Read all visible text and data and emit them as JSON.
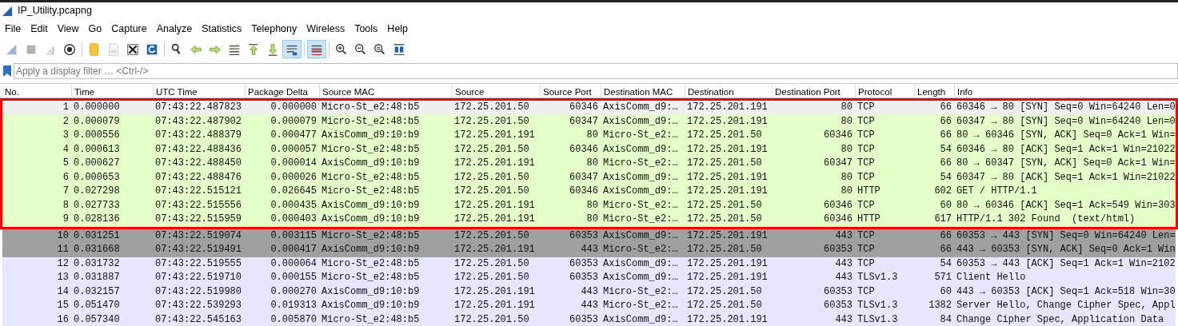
{
  "window": {
    "title": "IP_Utility.pcapng"
  },
  "menu": [
    "File",
    "Edit",
    "View",
    "Go",
    "Capture",
    "Analyze",
    "Statistics",
    "Telephony",
    "Wireless",
    "Tools",
    "Help"
  ],
  "toolbar": [
    {
      "kind": "fin",
      "disabled": true,
      "pressed": false
    },
    {
      "kind": "stop",
      "disabled": true,
      "pressed": false
    },
    {
      "kind": "restart",
      "disabled": true,
      "pressed": false
    },
    {
      "kind": "options",
      "disabled": false,
      "pressed": false
    },
    {
      "kind": "separator"
    },
    {
      "kind": "open",
      "disabled": false,
      "pressed": false
    },
    {
      "kind": "save",
      "disabled": true,
      "pressed": false
    },
    {
      "kind": "close",
      "disabled": false,
      "pressed": false
    },
    {
      "kind": "reload",
      "disabled": false,
      "pressed": false
    },
    {
      "kind": "separator"
    },
    {
      "kind": "find",
      "disabled": false,
      "pressed": false
    },
    {
      "kind": "back",
      "disabled": false,
      "pressed": false
    },
    {
      "kind": "forward",
      "disabled": false,
      "pressed": false
    },
    {
      "kind": "goto",
      "disabled": false,
      "pressed": false
    },
    {
      "kind": "first",
      "disabled": false,
      "pressed": false
    },
    {
      "kind": "last",
      "disabled": false,
      "pressed": false
    },
    {
      "kind": "autoscroll",
      "disabled": false,
      "pressed": true
    },
    {
      "kind": "separator"
    },
    {
      "kind": "colorize",
      "disabled": false,
      "pressed": true
    },
    {
      "kind": "separator"
    },
    {
      "kind": "zoomin",
      "disabled": false,
      "pressed": false
    },
    {
      "kind": "zoomout",
      "disabled": false,
      "pressed": false
    },
    {
      "kind": "zoomreset",
      "disabled": false,
      "pressed": false
    },
    {
      "kind": "resize",
      "disabled": false,
      "pressed": false
    }
  ],
  "filter": {
    "placeholder": "Apply a display filter … <Ctrl-/>"
  },
  "table": {
    "columns": [
      "No.",
      "Time",
      "UTC Time",
      "Package Delta",
      "Source MAC",
      "Source",
      "Source Port",
      "Destination MAC",
      "Destination",
      "Destination Port",
      "Protocol",
      "Length",
      "Info"
    ],
    "rows": [
      {
        "color": "#efefef",
        "highlighted": true,
        "cells": [
          "1",
          "0.000000",
          "07:43:22.487823",
          "0.000000",
          "Micro-St_e2:48:b5",
          "172.25.201.50",
          "60346",
          "AxisComm_d9:…",
          "172.25.201.191",
          "80",
          "TCP",
          "66",
          "60346 → 80 [SYN] Seq=0 Win=64240 Len=0"
        ]
      },
      {
        "color": "#e4ffc7",
        "highlighted": true,
        "cells": [
          "2",
          "0.000079",
          "07:43:22.487902",
          "0.000079",
          "Micro-St_e2:48:b5",
          "172.25.201.50",
          "60347",
          "AxisComm_d9:…",
          "172.25.201.191",
          "80",
          "TCP",
          "66",
          "60347 → 80 [SYN] Seq=0 Win=64240 Len=0"
        ]
      },
      {
        "color": "#e4ffc7",
        "highlighted": true,
        "cells": [
          "3",
          "0.000556",
          "07:43:22.488379",
          "0.000477",
          "AxisComm_d9:10:b9",
          "172.25.201.191",
          "80",
          "Micro-St_e2:…",
          "172.25.201.50",
          "60346",
          "TCP",
          "66",
          "80 → 60346 [SYN, ACK] Seq=0 Ack=1 Win="
        ]
      },
      {
        "color": "#e4ffc7",
        "highlighted": true,
        "cells": [
          "4",
          "0.000613",
          "07:43:22.488436",
          "0.000057",
          "Micro-St_e2:48:b5",
          "172.25.201.50",
          "60346",
          "AxisComm_d9:…",
          "172.25.201.191",
          "80",
          "TCP",
          "54",
          "60346 → 80 [ACK] Seq=1 Ack=1 Win=21022"
        ]
      },
      {
        "color": "#e4ffc7",
        "highlighted": true,
        "cells": [
          "5",
          "0.000627",
          "07:43:22.488450",
          "0.000014",
          "AxisComm_d9:10:b9",
          "172.25.201.191",
          "80",
          "Micro-St_e2:…",
          "172.25.201.50",
          "60347",
          "TCP",
          "66",
          "80 → 60347 [SYN, ACK] Seq=0 Ack=1 Win="
        ]
      },
      {
        "color": "#e4ffc7",
        "highlighted": true,
        "cells": [
          "6",
          "0.000653",
          "07:43:22.488476",
          "0.000026",
          "Micro-St_e2:48:b5",
          "172.25.201.50",
          "60347",
          "AxisComm_d9:…",
          "172.25.201.191",
          "80",
          "TCP",
          "54",
          "60347 → 80 [ACK] Seq=1 Ack=1 Win=21022"
        ]
      },
      {
        "color": "#e4ffc7",
        "highlighted": true,
        "cells": [
          "7",
          "0.027298",
          "07:43:22.515121",
          "0.026645",
          "Micro-St_e2:48:b5",
          "172.25.201.50",
          "60346",
          "AxisComm_d9:…",
          "172.25.201.191",
          "80",
          "HTTP",
          "602",
          "GET / HTTP/1.1"
        ]
      },
      {
        "color": "#e4ffc7",
        "highlighted": true,
        "cells": [
          "8",
          "0.027733",
          "07:43:22.515556",
          "0.000435",
          "AxisComm_d9:10:b9",
          "172.25.201.191",
          "80",
          "Micro-St_e2:…",
          "172.25.201.50",
          "60346",
          "TCP",
          "60",
          "80 → 60346 [ACK] Seq=1 Ack=549 Win=303"
        ]
      },
      {
        "color": "#e4ffc7",
        "highlighted": true,
        "cells": [
          "9",
          "0.028136",
          "07:43:22.515959",
          "0.000403",
          "AxisComm_d9:10:b9",
          "172.25.201.191",
          "80",
          "Micro-St_e2:…",
          "172.25.201.50",
          "60346",
          "HTTP",
          "617",
          "HTTP/1.1 302 Found  (text/html)"
        ]
      },
      {
        "color": "#a0a0a0",
        "highlighted": false,
        "cells": [
          "10",
          "0.031251",
          "07:43:22.519074",
          "0.003115",
          "Micro-St_e2:48:b5",
          "172.25.201.50",
          "60353",
          "AxisComm_d9:…",
          "172.25.201.191",
          "443",
          "TCP",
          "66",
          "60353 → 443 [SYN] Seq=0 Win=64240 Len="
        ]
      },
      {
        "color": "#a0a0a0",
        "highlighted": false,
        "cells": [
          "11",
          "0.031668",
          "07:43:22.519491",
          "0.000417",
          "AxisComm_d9:10:b9",
          "172.25.201.191",
          "443",
          "Micro-St_e2:…",
          "172.25.201.50",
          "60353",
          "TCP",
          "66",
          "443 → 60353 [SYN, ACK] Seq=0 Ack=1 Win"
        ]
      },
      {
        "color": "#e7e6ff",
        "highlighted": false,
        "cells": [
          "12",
          "0.031732",
          "07:43:22.519555",
          "0.000064",
          "Micro-St_e2:48:b5",
          "172.25.201.50",
          "60353",
          "AxisComm_d9:…",
          "172.25.201.191",
          "443",
          "TCP",
          "54",
          "60353 → 443 [ACK] Seq=1 Ack=1 Win=2102"
        ]
      },
      {
        "color": "#e7e6ff",
        "highlighted": false,
        "cells": [
          "13",
          "0.031887",
          "07:43:22.519710",
          "0.000155",
          "Micro-St_e2:48:b5",
          "172.25.201.50",
          "60353",
          "AxisComm_d9:…",
          "172.25.201.191",
          "443",
          "TLSv1.3",
          "571",
          "Client Hello"
        ]
      },
      {
        "color": "#e7e6ff",
        "highlighted": false,
        "cells": [
          "14",
          "0.032157",
          "07:43:22.519980",
          "0.000270",
          "AxisComm_d9:10:b9",
          "172.25.201.191",
          "443",
          "Micro-St_e2:…",
          "172.25.201.50",
          "60353",
          "TCP",
          "60",
          "443 → 60353 [ACK] Seq=1 Ack=518 Win=30"
        ]
      },
      {
        "color": "#e7e6ff",
        "highlighted": false,
        "cells": [
          "15",
          "0.051470",
          "07:43:22.539293",
          "0.019313",
          "AxisComm_d9:10:b9",
          "172.25.201.191",
          "443",
          "Micro-St_e2:…",
          "172.25.201.50",
          "60353",
          "TLSv1.3",
          "1382",
          "Server Hello, Change Cipher Spec, Appl"
        ]
      },
      {
        "color": "#e7e6ff",
        "highlighted": false,
        "cells": [
          "16",
          "0.057340",
          "07:43:22.545163",
          "0.005870",
          "Micro-St_e2:48:b5",
          "172.25.201.50",
          "60353",
          "AxisComm_d9:…",
          "172.25.201.191",
          "443",
          "TLSv1.3",
          "84",
          "Change Cipher Spec, Application Data"
        ]
      }
    ]
  }
}
